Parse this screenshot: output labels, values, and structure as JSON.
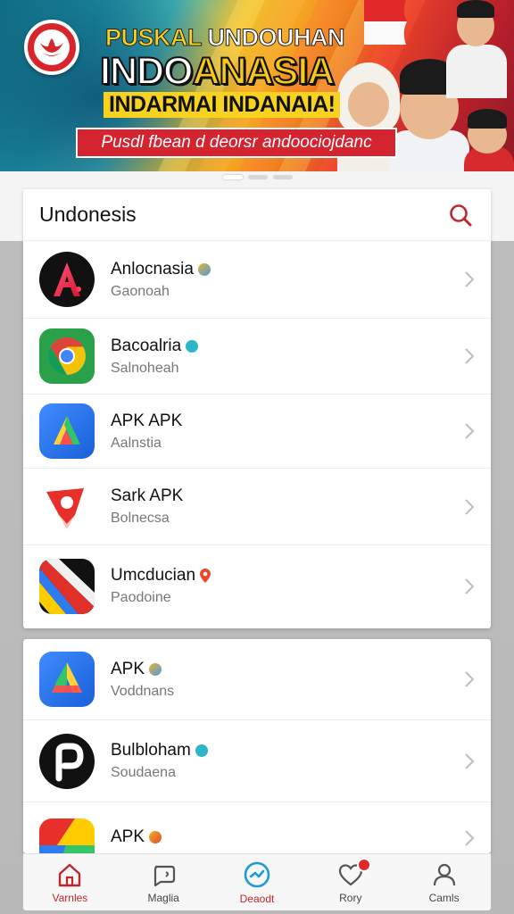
{
  "banner": {
    "line1_yellow": "PUSKAL",
    "line1_white": "UNDOUHAN",
    "line2_white": "INDO",
    "line2_yellow": "ANASIA",
    "line3": "INDARMAI INDANAIA!",
    "cta": "Pusdl fbean d deorsr andoociojdanc"
  },
  "carousel": {
    "count": 3,
    "active": 0
  },
  "list_card": {
    "title": "Undonesis",
    "items": [
      {
        "name": "Anlocnasia",
        "sub": "Gaonoah",
        "badge_color": "#e88a2a",
        "icon": "a-logo-icon"
      },
      {
        "name": "Bacoalria",
        "sub": "Salnoheah",
        "badge_color": "#2cb6c9",
        "icon": "chrome-icon"
      },
      {
        "name": "APK APK",
        "sub": "Aalnstia",
        "badge_color": null,
        "icon": "play-triangle-icon"
      },
      {
        "name": "Sark APK",
        "sub": "Bolnecsa",
        "badge_color": null,
        "icon": "red-pin-icon"
      },
      {
        "name": "Umcducian",
        "sub": "Paodoine",
        "badge_color": "#e84a2a",
        "icon": "stripes-icon"
      }
    ]
  },
  "list_card_2": {
    "items": [
      {
        "name": "APK",
        "sub": "Voddnans",
        "badge_color": "#e88a2a",
        "icon": "drive-icon"
      },
      {
        "name": "Bulbloham",
        "sub": "Soudaena",
        "badge_color": "#2cb6c9",
        "icon": "p-logo-icon"
      },
      {
        "name": "APK",
        "sub": "",
        "badge_color": "#e84a2a",
        "icon": "colorful-square-icon"
      }
    ]
  },
  "bottom_nav": [
    {
      "label": "Varnles",
      "icon": "home-icon"
    },
    {
      "label": "Maglia",
      "icon": "chat-icon"
    },
    {
      "label": "Deaodt",
      "icon": "compass-icon"
    },
    {
      "label": "Rory",
      "icon": "heart-icon"
    },
    {
      "label": "Camls",
      "icon": "profile-icon"
    }
  ],
  "colors": {
    "accent": "#c0272d",
    "banner_cta": "#d32430"
  }
}
